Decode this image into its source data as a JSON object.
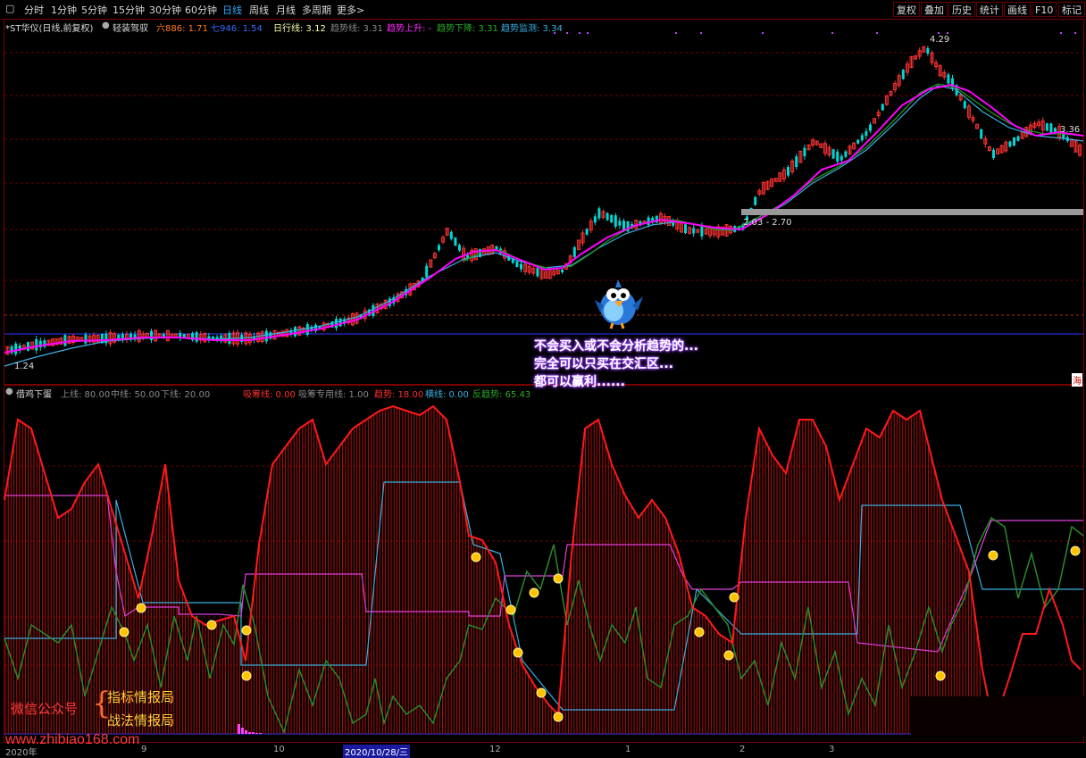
{
  "toolbar": {
    "periods": [
      "分时",
      "1分钟",
      "5分钟",
      "15分钟",
      "30分钟",
      "60分钟",
      "日线",
      "周线",
      "月线",
      "多周期",
      "更多"
    ],
    "more_arrow": ">",
    "right": [
      "复权",
      "叠加",
      "历史",
      "统计",
      "画线",
      "F10",
      "标记"
    ]
  },
  "main_info": {
    "stock": "*ST华仪(日线,前复权)",
    "indicator": "轻装驾驭",
    "line1": "六886: 1.71",
    "line2": "七946: 1.54",
    "line3": "日行线: 3.12",
    "line4": "趋势线: 3.31",
    "line5": "趋势上升: -",
    "line6": "趋势下降: 3.31",
    "line7": "趋势监测: 3.34"
  },
  "main_labels": {
    "high": "4.29",
    "right": "3.36",
    "mid": "2.03 - 2.70",
    "low": "1.24",
    "corner": "海"
  },
  "callout": [
    "不会买入或不会分析趋势的...",
    "完全可以只买在交汇区...",
    "都可以赢利......"
  ],
  "sub_info": {
    "name": "借鸡下蛋",
    "upper": "上线: 80.00",
    "middle": "中线: 50.00",
    "lower": "下线: 20.00",
    "v1": "吸筹线: 0.00",
    "v2": "吸筹专用线: 1.00",
    "v3": "趋势: 18.00",
    "v4": "横线: 0.00",
    "v5": "反趋势: 65.43"
  },
  "watermark": {
    "label": "微信公众号",
    "brace": "{",
    "line1": "指标情报局",
    "line2": "战法情报局",
    "url": "www.zhibiao168.com"
  },
  "xaxis": [
    "2020年",
    "9",
    "10",
    "2020/10/28/三",
    "12",
    "1",
    "2",
    "3"
  ],
  "colors": {
    "up": "#ff3232",
    "down": "#00e6e6",
    "magenta": "#ff00ff",
    "green": "#1a8a1a",
    "cyan": "#3ab0e0",
    "red_osc": "#ff1a1a",
    "osc_green": "#2a8a2a"
  }
}
